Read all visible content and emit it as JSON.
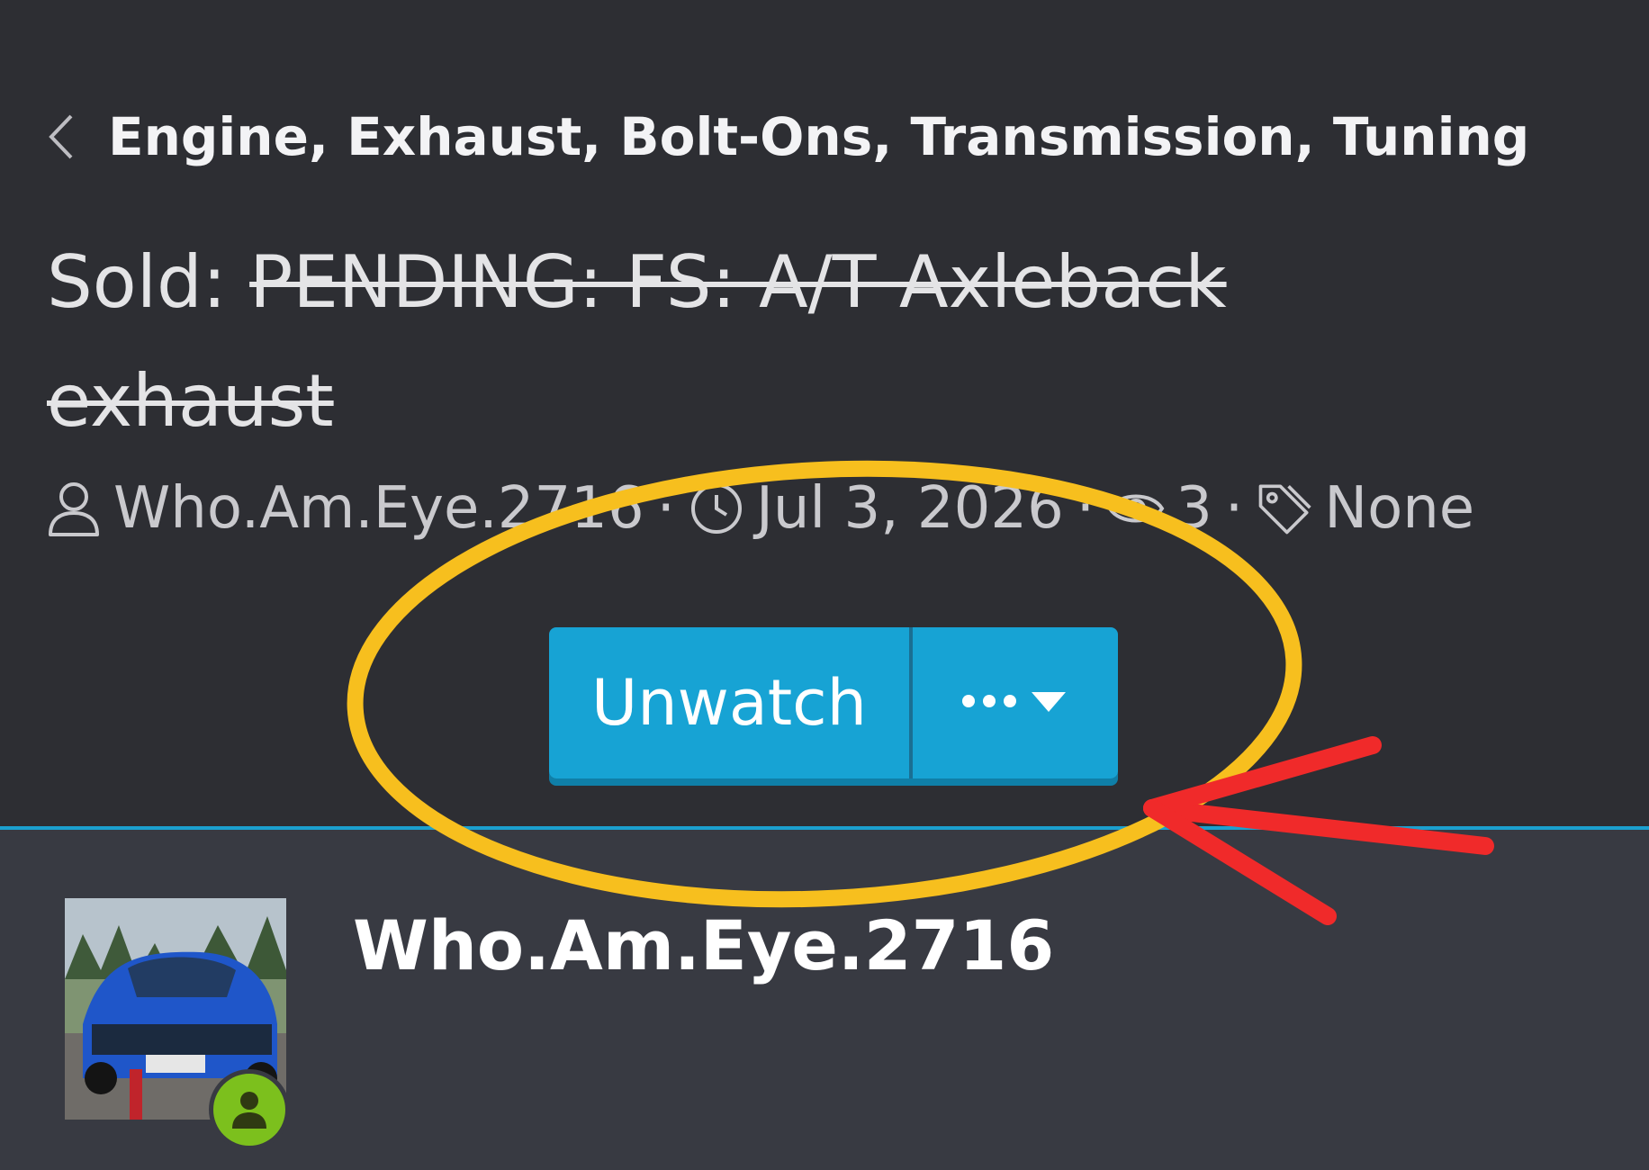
{
  "breadcrumb": {
    "label": "Engine, Exhaust, Bolt-Ons, Transmission, Tuning"
  },
  "thread": {
    "prefix": "Sold:",
    "title_struck": "PENDING: FS: A/T Axleback exhaust"
  },
  "meta": {
    "author": "Who.Am.Eye.2716",
    "date": "Jul 3, 2026",
    "separator": "·",
    "views": "3",
    "tags": "None"
  },
  "actions": {
    "watch_label": "Unwatch",
    "more_icon": "ellipsis-caret-icon"
  },
  "post": {
    "username": "Who.Am.Eye.2716",
    "online_icon": "user-online-icon"
  },
  "colors": {
    "page_bg": "#2d2e33",
    "post_bg": "#383a42",
    "accent": "#17a3d4",
    "annotation_circle": "#f7bf1e",
    "annotation_arrow": "#f02a2a",
    "online": "#7cc01d"
  }
}
